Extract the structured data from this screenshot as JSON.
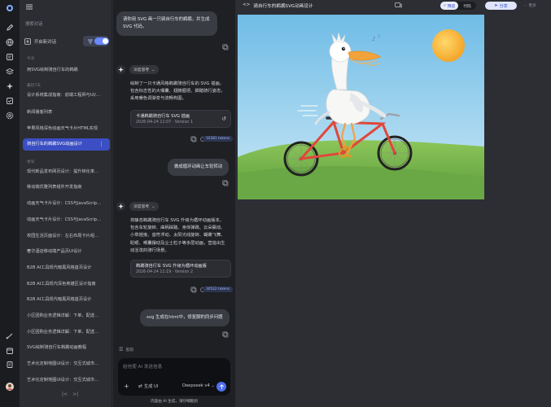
{
  "sidebar": {
    "search_placeholder": "搜索对话",
    "new_chat": "开启新对话",
    "filter": "过滤",
    "groups": [
      "今天",
      "最近7天",
      "更早"
    ],
    "items": [
      "用SVG绘制骑自行车的鹈鹕",
      "设计系统集成指南：前端工程师与UI/…",
      "新闻播客列表",
      "苹果风格深色动画天气卡片HTML实现",
      "骑自行车的鹈鹕SVG动画设计",
      "现代新品发布网页设计：提升转化率…",
      "移动端优雅列表组件开发指南",
      "动画天气卡片设计：CSS与JavaScrip…",
      "动画天气卡片设计：CSS与JavaScrip…",
      "校园生活页面设计：左右布局卡片组…",
      "奢华酒店移动端产品页UI设计",
      "B2B AI工具现代暗黑风格首页设计",
      "B2B AI工具现代深色英雄区设计指南",
      "B2B AI工具现代暗黑风格首页设计",
      "小区团购业务逻辑详解：下单、配送…",
      "小区团购业务逻辑详解：下单、配送…",
      "SVG绘制骑自行车鹈鹕动画教程",
      "艺术化定制地图UI设计：交互式城市…",
      "艺术化定制地图UI设计：交互式城市…"
    ],
    "active_index": 4
  },
  "chat": {
    "msg1_user": "请你用 SVG 画一只骑自行车的鹈鹕，并生成 SVG 代码。",
    "think_label": "深度思考",
    "ai1_text": "绘制了一只卡通风格鹈鹕骑自行车的 SVG 插画，包含标志性的大嘴囊、翅膀握把、脚踏骑行姿态，采用暖色调渐变与流畅构图。",
    "card1_title": "卡通鹈鹕骑自行车 SVG 插画",
    "card1_sub": "2026-04-24 11:07 · Version 1",
    "tokens1": "10381 tokens",
    "msg2_user": "做成循环动画让车轮转动",
    "ai2_text": "将静态鹈鹕骑自行车 SVG 升级为循环动画版本，包含车轮旋转、曲柄踩踏、身体弹跳、云朵飘动、小草摇曳、音符浮动、太阳光线旋转、蝴蝶飞舞、眨眼、喉囊摆动及尘土粒子等多层动画，营造出生动活泼的骑行场景。",
    "card2_title": "鹈鹕骑自行车 SVG 升级为循环动画版",
    "card2_sub": "2026-04-24 11:19 · Version 2",
    "tokens2": "30522 tokens",
    "msg3_user": "svg 生成在html中，修复脚的同步问题",
    "thinking_label": "思前",
    "composer_placeholder": "给信使 AI 发送信息",
    "generate_ui": "生成 UI",
    "model": "Deepseek v4",
    "disclaimer": "内容由 AI 生成，请仔细甄别"
  },
  "preview": {
    "title": "骑自行车的鹈鹕SVG动画设计",
    "tab_preview": "预览",
    "tab_code": "代码",
    "share": "分享",
    "more": "更多"
  },
  "colors": {
    "accent": "#3b4ec3",
    "sky_top": "#86c6ea",
    "grass": "#7ab84f",
    "sun": "#f6b53a",
    "bike_frame": "#e0473a"
  }
}
